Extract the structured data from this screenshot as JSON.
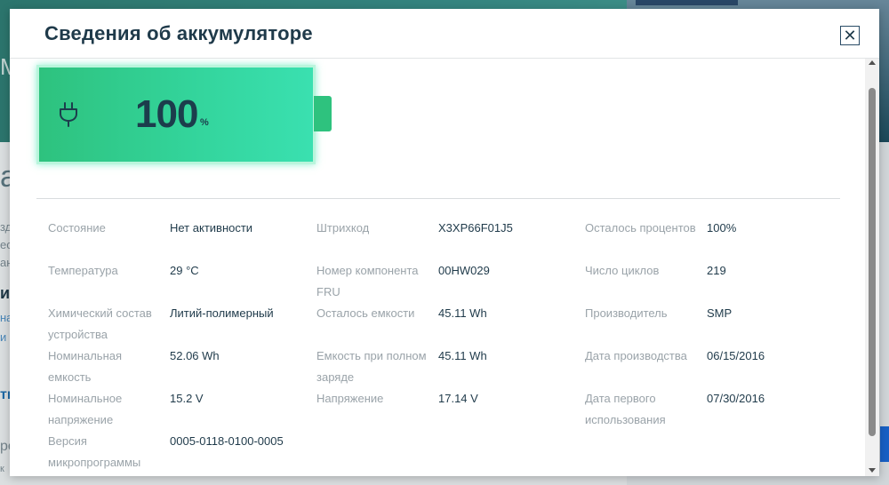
{
  "dialog": {
    "title": "Сведения об аккумуляторе",
    "close_label": "✕"
  },
  "battery": {
    "charge_value": "100",
    "charge_unit": "%",
    "charge_fraction": 1.0,
    "icon": "plug-icon",
    "colors": {
      "fill": "#2ec27e",
      "fill_end": "#3ae0b0",
      "glow": "#b9f5dc",
      "text": "#1c3d4c"
    }
  },
  "properties": {
    "col1": [
      {
        "label": "Состояние",
        "value": "Нет активности"
      },
      {
        "label": "Температура",
        "value": "29 °C"
      },
      {
        "label": "Химический состав устройства",
        "value": "Литий-полимерный"
      },
      {
        "label": "Номинальная емкость",
        "value": "52.06 Wh"
      },
      {
        "label": "Номинальное напряжение",
        "value": "15.2 V"
      },
      {
        "label": "Версия микропрограммы",
        "value": "0005-0118-0100-0005"
      }
    ],
    "col2": [
      {
        "label": "Штрихкод",
        "value": "X3XP66F01J5"
      },
      {
        "label": "Номер компонента FRU",
        "value": "00HW029"
      },
      {
        "label": "Осталось емкости",
        "value": "45.11 Wh"
      },
      {
        "label": "Емкость при полном заряде",
        "value": "45.11 Wh"
      },
      {
        "label": "Напряжение",
        "value": "17.14 V"
      }
    ],
    "col3": [
      {
        "label": "Осталось процентов",
        "value": "100%"
      },
      {
        "label": "Число циклов",
        "value": "219"
      },
      {
        "label": "Производитель",
        "value": "SMP"
      },
      {
        "label": "Дата производства",
        "value": "06/15/2016"
      },
      {
        "label": "Дата первого использования",
        "value": "07/30/2016"
      }
    ]
  },
  "background": {
    "fragments": [
      "М",
      "а",
      "зд",
      "ес",
      "ан",
      "и",
      "на",
      "и",
      "ти",
      "ро",
      "к"
    ]
  }
}
